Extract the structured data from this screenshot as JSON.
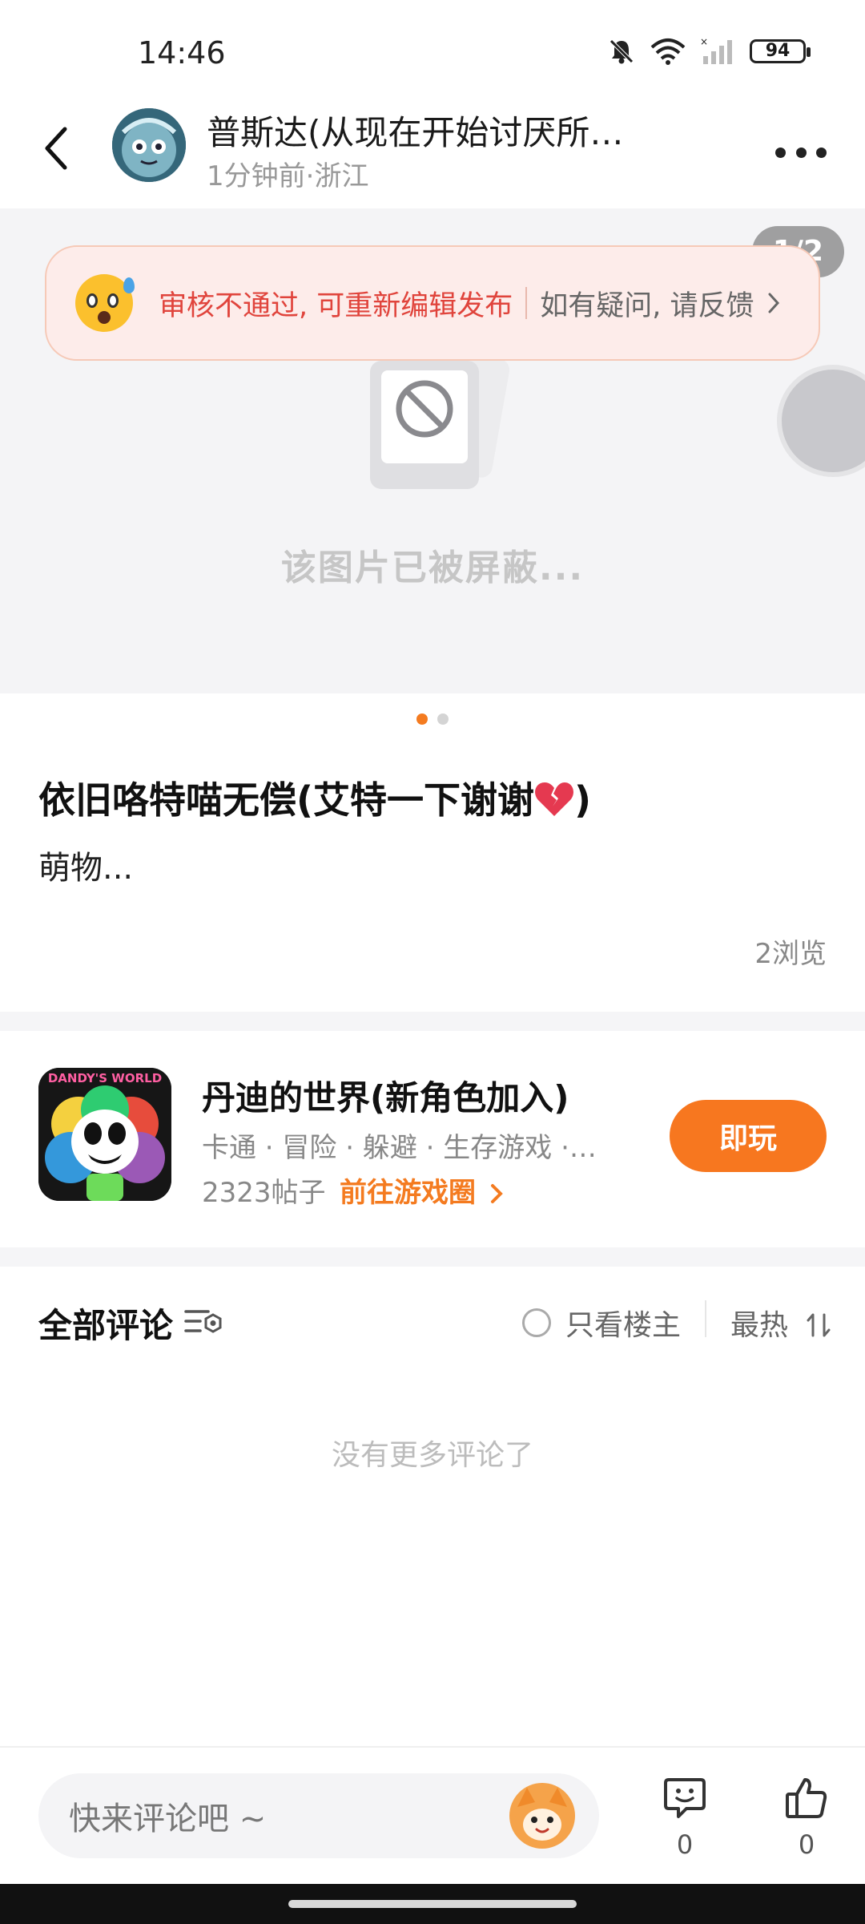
{
  "status_bar": {
    "time": "14:46",
    "battery": "94"
  },
  "header": {
    "author_name": "普斯达(从现在开始讨厌所有...",
    "post_meta": "1分钟前·浙江"
  },
  "image_viewer": {
    "page_counter": "1/2",
    "blocked_text": "该图片已被屏蔽..."
  },
  "review_banner": {
    "message": "审核不通过, 可重新编辑发布",
    "feedback_link": "如有疑问, 请反馈"
  },
  "post": {
    "title": "依旧咯特喵无偿(艾特一下谢谢",
    "title_suffix": ")",
    "body": "萌物...",
    "views": "2浏览"
  },
  "game_card": {
    "icon_text": "DANDY'S WORLD",
    "name": "丹迪的世界(新角色加入)",
    "tags": "卡通 · 冒险 · 躲避 · 生存游戏 · ...",
    "posts": "2323帖子",
    "link": "前往游戏圈",
    "play_label": "即玩"
  },
  "comments": {
    "title": "全部评论",
    "owner_only_label": "只看楼主",
    "sort_label": "最热",
    "empty_text": "没有更多评论了"
  },
  "bottom_bar": {
    "input_placeholder": "快来评论吧 ~",
    "comment_count": "0",
    "like_count": "0"
  },
  "colors": {
    "accent": "#f7771f",
    "review_text": "#e0443c"
  }
}
